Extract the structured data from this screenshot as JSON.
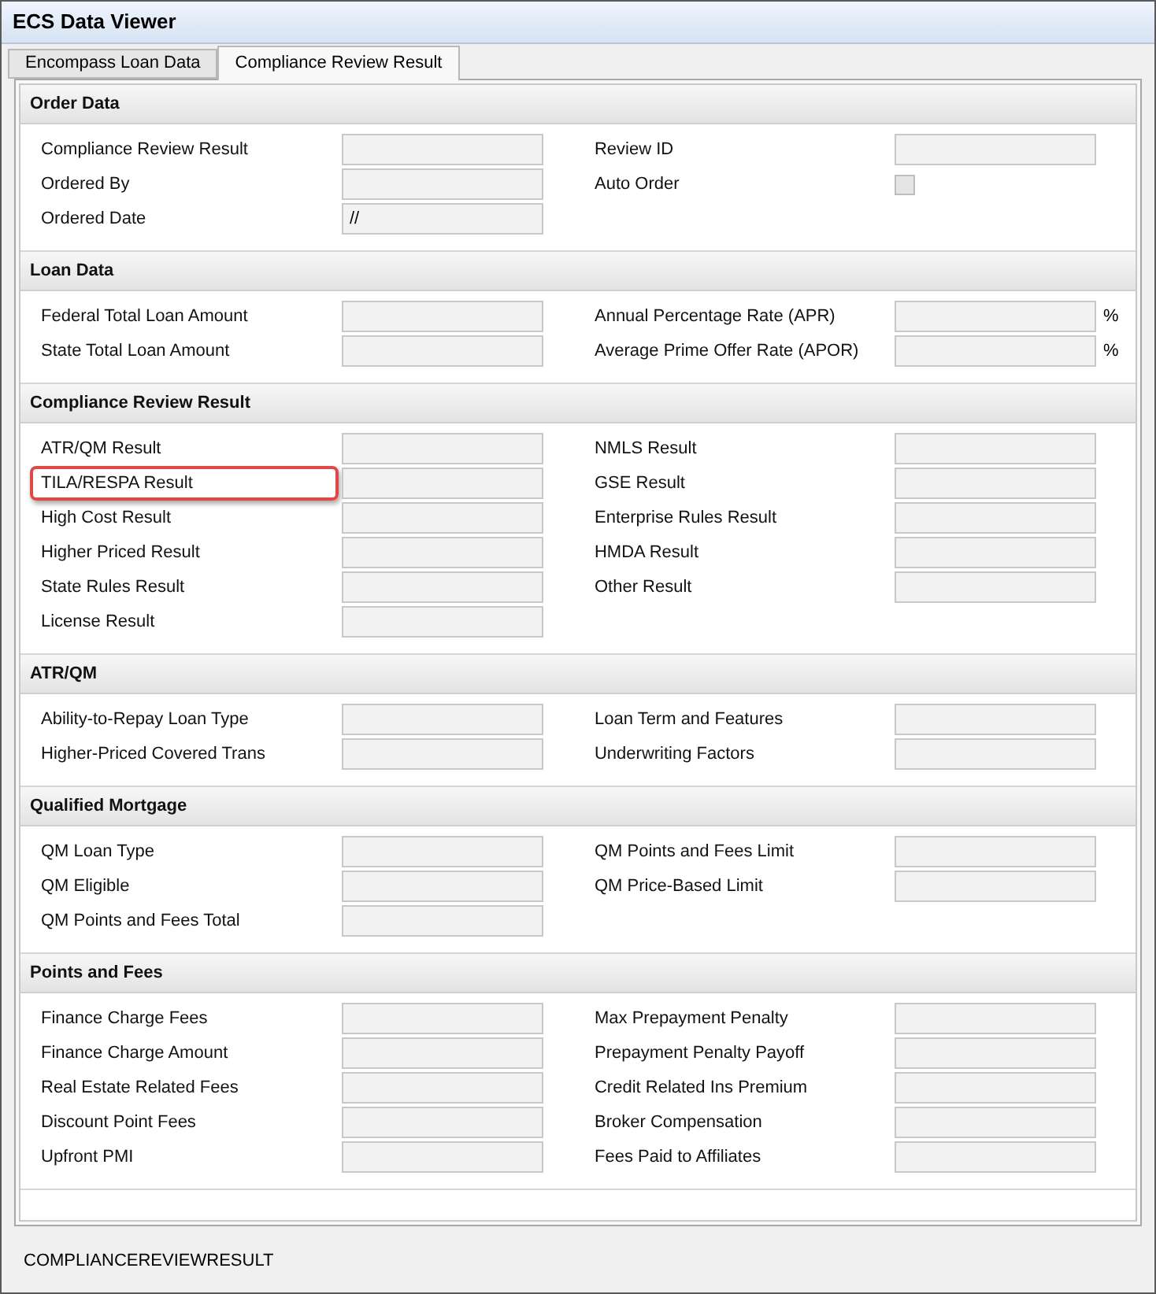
{
  "window": {
    "title": "ECS Data Viewer"
  },
  "tabs": [
    {
      "label": "Encompass Loan Data",
      "selected": false
    },
    {
      "label": "Compliance Review Result",
      "selected": true
    }
  ],
  "sections": [
    {
      "title": "Order Data",
      "left": [
        {
          "label": "Compliance Review Result",
          "kind": "text"
        },
        {
          "label": "Ordered By",
          "kind": "text"
        },
        {
          "label": "Ordered Date",
          "kind": "text",
          "value": "//"
        }
      ],
      "right": [
        {
          "label": "Review ID",
          "kind": "text"
        },
        {
          "label": "Auto Order",
          "kind": "checkbox",
          "checked": false
        }
      ]
    },
    {
      "title": "Loan Data",
      "left": [
        {
          "label": "Federal Total Loan Amount",
          "kind": "text"
        },
        {
          "label": "State Total Loan Amount",
          "kind": "text"
        }
      ],
      "right": [
        {
          "label": "Annual Percentage Rate (APR)",
          "kind": "text",
          "unit": "%"
        },
        {
          "label": "Average Prime Offer Rate (APOR)",
          "kind": "text",
          "unit": "%"
        }
      ]
    },
    {
      "title": "Compliance Review Result",
      "left": [
        {
          "label": "ATR/QM Result",
          "kind": "text"
        },
        {
          "label": "TILA/RESPA Result",
          "kind": "text",
          "highlighted": true
        },
        {
          "label": "High Cost Result",
          "kind": "text"
        },
        {
          "label": "Higher Priced Result",
          "kind": "text"
        },
        {
          "label": "State Rules Result",
          "kind": "text"
        },
        {
          "label": "License Result",
          "kind": "text"
        }
      ],
      "right": [
        {
          "label": "NMLS Result",
          "kind": "text"
        },
        {
          "label": "GSE Result",
          "kind": "text"
        },
        {
          "label": "Enterprise Rules Result",
          "kind": "text"
        },
        {
          "label": "HMDA Result",
          "kind": "text"
        },
        {
          "label": "Other Result",
          "kind": "text"
        }
      ]
    },
    {
      "title": "ATR/QM",
      "left": [
        {
          "label": "Ability-to-Repay Loan Type",
          "kind": "text"
        },
        {
          "label": "Higher-Priced Covered Trans",
          "kind": "text"
        }
      ],
      "right": [
        {
          "label": "Loan Term and Features",
          "kind": "text"
        },
        {
          "label": "Underwriting Factors",
          "kind": "text"
        }
      ]
    },
    {
      "title": "Qualified Mortgage",
      "left": [
        {
          "label": "QM Loan Type",
          "kind": "text"
        },
        {
          "label": "QM Eligible",
          "kind": "text"
        },
        {
          "label": "QM Points and Fees Total",
          "kind": "text"
        }
      ],
      "right": [
        {
          "label": "QM Points and Fees Limit",
          "kind": "text"
        },
        {
          "label": "QM Price-Based Limit",
          "kind": "text"
        }
      ]
    },
    {
      "title": "Points and Fees",
      "left": [
        {
          "label": "Finance Charge Fees",
          "kind": "text"
        },
        {
          "label": "Finance Charge Amount",
          "kind": "text"
        },
        {
          "label": "Real Estate Related Fees",
          "kind": "text"
        },
        {
          "label": "Discount Point Fees",
          "kind": "text"
        },
        {
          "label": "Upfront PMI",
          "kind": "text"
        }
      ],
      "right": [
        {
          "label": "Max Prepayment Penalty",
          "kind": "text"
        },
        {
          "label": "Prepayment Penalty Payoff",
          "kind": "text"
        },
        {
          "label": "Credit Related Ins Premium",
          "kind": "text"
        },
        {
          "label": "Broker Compensation",
          "kind": "text"
        },
        {
          "label": "Fees Paid to Affiliates",
          "kind": "text"
        }
      ]
    }
  ],
  "status_bar": {
    "text": "COMPLIANCEREVIEWRESULT"
  }
}
